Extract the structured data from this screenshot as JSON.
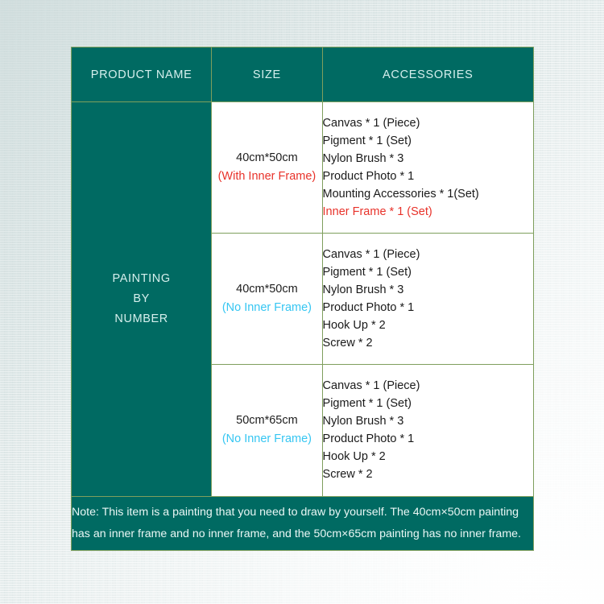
{
  "table": {
    "headers": {
      "product_name": "PRODUCT NAME",
      "size": "SIZE",
      "accessories": "ACCESSORIES"
    },
    "product_name": {
      "line1": "PAINTING",
      "line2": "BY",
      "line3": "NUMBER"
    },
    "rows": [
      {
        "size_dimension": "40cm*50cm",
        "size_frame_note": "(With Inner Frame)",
        "size_frame_note_color": "#e8322a",
        "accessories": [
          {
            "text": "Canvas * 1 (Piece)",
            "highlight": false
          },
          {
            "text": "Pigment * 1 (Set)",
            "highlight": false
          },
          {
            "text": "Nylon Brush * 3",
            "highlight": false
          },
          {
            "text": "Product Photo * 1",
            "highlight": false
          },
          {
            "text": "Mounting Accessories * 1(Set)",
            "highlight": false
          },
          {
            "text": "Inner Frame * 1 (Set)",
            "highlight": true
          }
        ]
      },
      {
        "size_dimension": "40cm*50cm",
        "size_frame_note": "(No Inner Frame)",
        "size_frame_note_color": "#36c6f2",
        "accessories": [
          {
            "text": "Canvas * 1 (Piece)",
            "highlight": false
          },
          {
            "text": "Pigment * 1 (Set)",
            "highlight": false
          },
          {
            "text": "Nylon Brush * 3",
            "highlight": false
          },
          {
            "text": "Product Photo * 1",
            "highlight": false
          },
          {
            "text": "Hook Up * 2",
            "highlight": false
          },
          {
            "text": "Screw * 2",
            "highlight": false
          }
        ]
      },
      {
        "size_dimension": "50cm*65cm",
        "size_frame_note": "(No Inner Frame)",
        "size_frame_note_color": "#36c6f2",
        "accessories": [
          {
            "text": "Canvas * 1 (Piece)",
            "highlight": false
          },
          {
            "text": "Pigment * 1 (Set)",
            "highlight": false
          },
          {
            "text": "Nylon Brush * 3",
            "highlight": false
          },
          {
            "text": "Product Photo * 1",
            "highlight": false
          },
          {
            "text": "Hook Up * 2",
            "highlight": false
          },
          {
            "text": "Screw * 2",
            "highlight": false
          }
        ]
      }
    ],
    "note": {
      "line1": "Note: This item is a painting that you need to draw by yourself. The 40cm×50cm painting",
      "line2": "has an inner frame and no inner frame, and the 50cm×65cm painting has no inner frame."
    }
  },
  "colors": {
    "teal": "#006a62",
    "border_green": "#7f9f5d",
    "header_text": "#d6efed",
    "red": "#e8322a",
    "cyan": "#36c6f2",
    "background": "#e4ebeb"
  }
}
